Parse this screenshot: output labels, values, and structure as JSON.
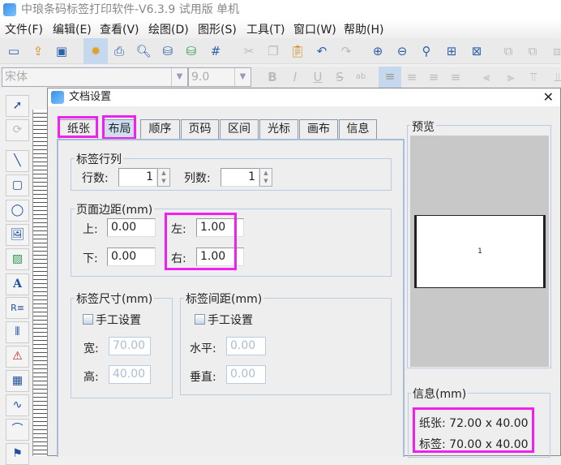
{
  "app": {
    "title": "中琅条码标签打印软件-V6.3.9 试用版 单机"
  },
  "menu": [
    "文件(F)",
    "编辑(E)",
    "查看(V)",
    "绘图(D)",
    "图形(S)",
    "工具(T)",
    "窗口(W)",
    "帮助(H)"
  ],
  "format": {
    "font": "宋体",
    "size": "9.0"
  },
  "dialog": {
    "title": "文档设置",
    "tabs": [
      "纸张",
      "布局",
      "顺序",
      "页码",
      "区间",
      "光标",
      "画布",
      "信息"
    ],
    "selected_tab": "布局",
    "rows_cols": {
      "title": "标签行列",
      "rows_label": "行数:",
      "rows": "1",
      "cols_label": "列数:",
      "cols": "1"
    },
    "margins": {
      "title": "页面边距(mm)",
      "top_label": "上:",
      "top": "0.00",
      "bottom_label": "下:",
      "bottom": "0.00",
      "left_label": "左:",
      "left": "1.00",
      "right_label": "右:",
      "right": "1.00"
    },
    "label_size": {
      "title": "标签尺寸(mm)",
      "manual": "手工设置",
      "manual_checked": false,
      "width_label": "宽:",
      "width": "70.00",
      "height_label": "高:",
      "height": "40.00"
    },
    "label_gap": {
      "title": "标签间距(mm)",
      "manual": "手工设置",
      "manual_checked": false,
      "h_label": "水平:",
      "h": "0.00",
      "v_label": "垂直:",
      "v": "0.00"
    },
    "preview": {
      "title": "预览",
      "page_number": "1"
    },
    "info": {
      "title": "信息(mm)",
      "paper": "纸张: 72.00 x 40.00",
      "label": "标签: 70.00 x 40.00"
    }
  },
  "colors": {
    "highlight": "#f020f0",
    "selected_tab": "#cfdff0"
  }
}
